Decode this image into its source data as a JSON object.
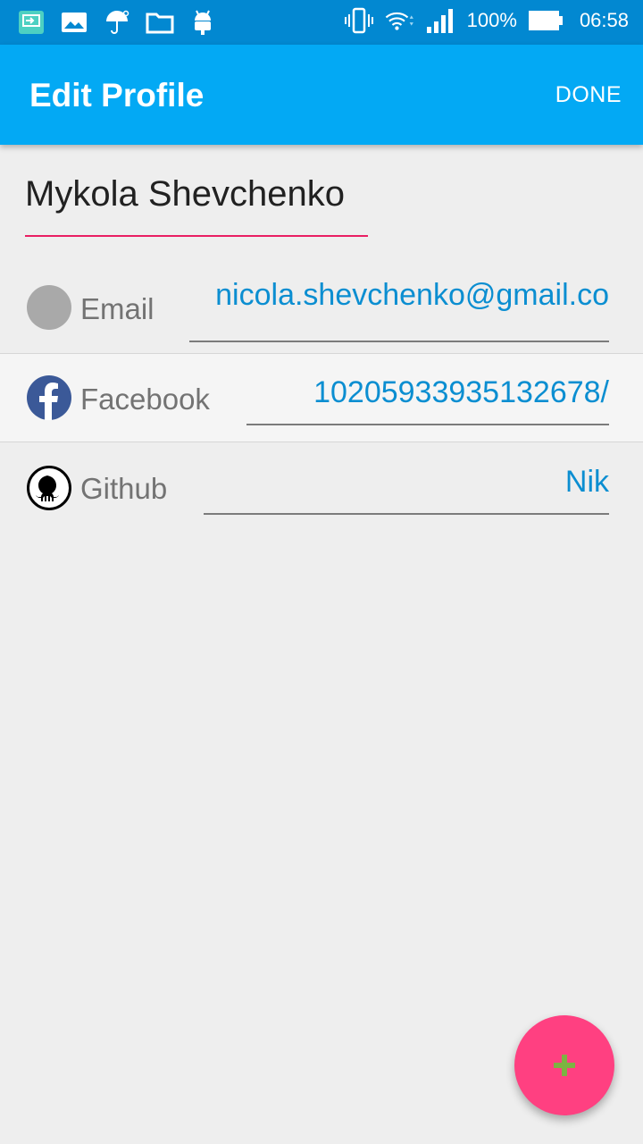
{
  "status_bar": {
    "battery": "100%",
    "time": "06:58"
  },
  "app_bar": {
    "title": "Edit Profile",
    "done_label": "DONE"
  },
  "profile": {
    "name": "Mykola Shevchenko"
  },
  "fields": [
    {
      "label": "Email",
      "value": "nicola.shevchenko@gmail.co",
      "icon": "email-icon"
    },
    {
      "label": "Facebook",
      "value": "10205933935132678/",
      "icon": "facebook-icon"
    },
    {
      "label": "Github",
      "value": "Nik",
      "icon": "github-icon"
    }
  ],
  "fab": {
    "icon": "plus-icon",
    "plus_color": "#7cb342",
    "background": "#ff4081"
  },
  "colors": {
    "accent": "#03a9f4",
    "status_bar": "#0288d1",
    "value_text": "#0b8ed1",
    "underline_active": "#e91e63"
  }
}
